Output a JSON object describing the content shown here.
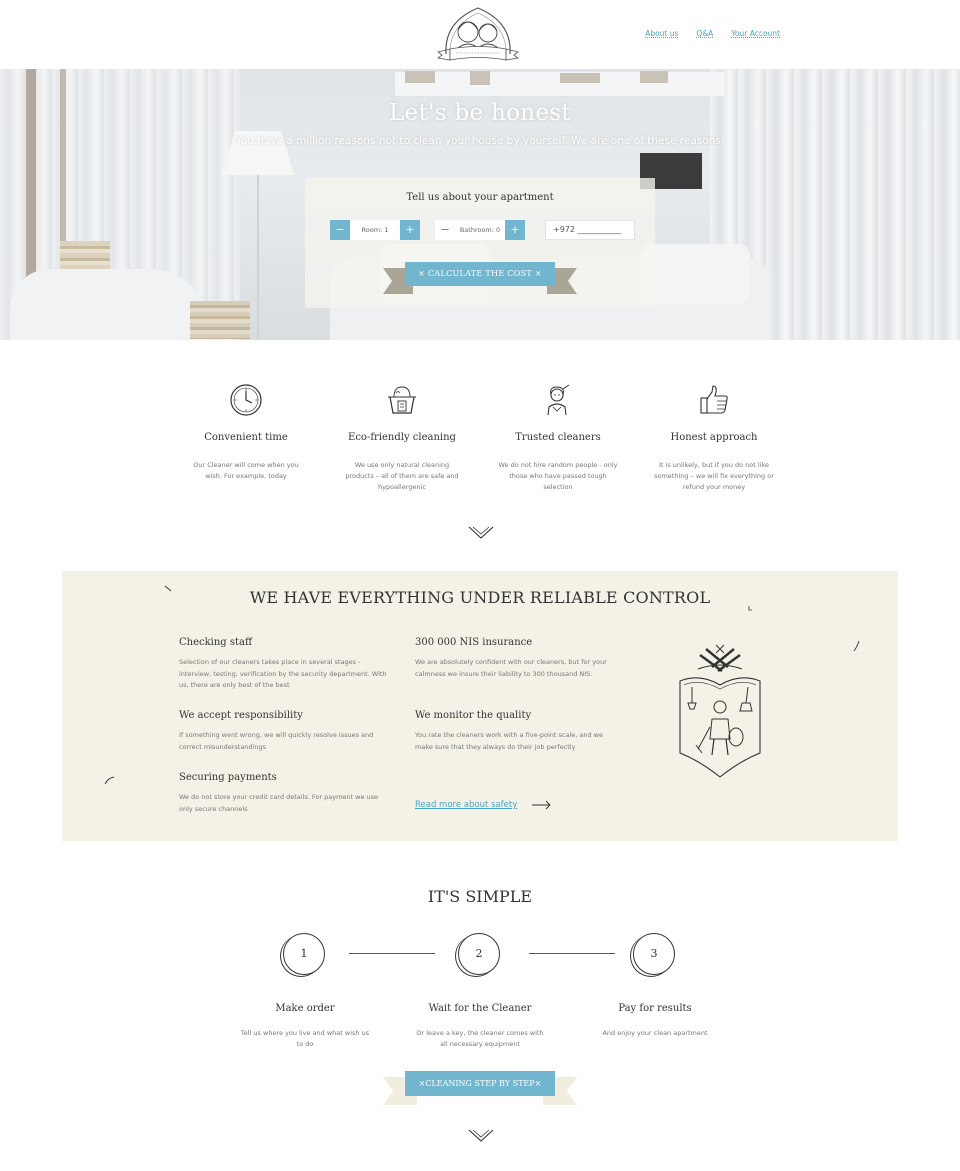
{
  "header": {
    "nav": [
      {
        "label": "About us"
      },
      {
        "label": "Q&A"
      },
      {
        "label": "Your Account"
      }
    ]
  },
  "hero": {
    "title": "Let's be honest",
    "subtitle": "You have a million reasons not to clean your house by yourself. We are one of these reasons."
  },
  "calculator": {
    "title": "Tell us about your apartment",
    "room": {
      "minus": "−",
      "value": "Room: 1",
      "plus": "+"
    },
    "bathroom": {
      "minus": "−",
      "value": "Bathroom: 0",
      "plus": "+"
    },
    "phone_value": "+972 ___________",
    "button": "×  CALCULATE THE COST  ×"
  },
  "features": [
    {
      "title": "Convenient time",
      "desc": "Our Cleaner will come when you wish. For example, today",
      "icon": "clock-icon"
    },
    {
      "title": "Eco-friendly cleaning",
      "desc": "We use only natural cleaning products – all of them are safe and hypoallergenic",
      "icon": "eco-bucket-icon"
    },
    {
      "title": "Trusted cleaners",
      "desc": "We do not hire random people - only those who have passed tough selection",
      "icon": "cleaner-woman-icon"
    },
    {
      "title": "Honest approach",
      "desc": "It is unlikely, but if you do not like something – we will fix everything or refund your money",
      "icon": "thumbs-up-icon"
    }
  ],
  "control": {
    "title": "WE HAVE EVERYTHING UNDER RELIABLE CONTROL",
    "items": [
      {
        "title": "Checking staff",
        "desc": "Selection of our cleaners takes place in several stages - interview, testing, verification by the security department. With us, there are only best of the best"
      },
      {
        "title": "300 000 NIS insurance",
        "desc": "We are absolutely confident with our cleaners, but for your calmness we insure their liability to 300 thousand NIS."
      },
      {
        "title": "We accept responsibility",
        "desc": "If something went wrong, we will quickly resolve issues and correct misunderstandings"
      },
      {
        "title": "We monitor the quality",
        "desc": "You rate the cleaners work with a five-point scale, and we make sure that they always do their job perfectly"
      },
      {
        "title": "Securing payments",
        "desc": "We do not store your credit card details. For payment we use only secure channels"
      }
    ],
    "read_more": "Read more about safety"
  },
  "simple": {
    "title": "IT'S SIMPLE",
    "steps": [
      {
        "num": "1",
        "title": "Make order",
        "desc": "Tell us where you live and what wish us to do"
      },
      {
        "num": "2",
        "title": "Wait for the Cleaner",
        "desc": "Or leave a key, the cleaner comes with all necessary equipment"
      },
      {
        "num": "3",
        "title": "Pay for results",
        "desc": "And enjoy your clean apartment"
      }
    ],
    "button": "×CLEANING STEP BY STEP×"
  },
  "colors": {
    "accent": "#71b5cf",
    "link": "#4aa3c8",
    "panel": "#f4f2e6"
  }
}
